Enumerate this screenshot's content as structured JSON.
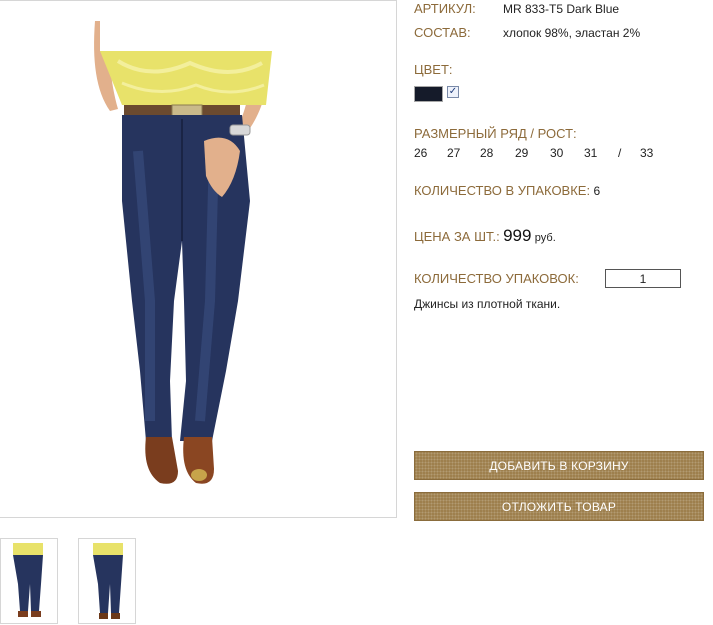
{
  "product": {
    "article_label": "АРТИКУЛ:",
    "article_value": "MR 833-T5 Dark Blue",
    "composition_label": "СОСТАВ:",
    "composition_value": "хлопок 98%, эластан 2%",
    "color_label": "ЦВЕТ:",
    "color_swatch": "#151b2a",
    "color_checked": true,
    "size_label": "РАЗМЕРНЫЙ РЯД / РОСТ:",
    "sizes": [
      "26",
      "27",
      "28",
      "29",
      "30",
      "31",
      "/",
      "33"
    ],
    "pack_qty_label": "КОЛИЧЕСТВО В УПАКОВКЕ:",
    "pack_qty_value": "6",
    "price_label": "ЦЕНА ЗА ШТ.:",
    "price_value": "999",
    "price_currency": "руб.",
    "packs_label": "КОЛИЧЕСТВО УПАКОВОК:",
    "packs_value": "1",
    "description": "Джинсы из плотной ткани."
  },
  "actions": {
    "add_to_cart": "ДОБАВИТЬ В КОРЗИНУ",
    "save_for_later": "ОТЛОЖИТЬ ТОВАР"
  },
  "colors": {
    "label": "#8c6a3a",
    "button": "#9c7d4a",
    "denim": "#26345e"
  }
}
